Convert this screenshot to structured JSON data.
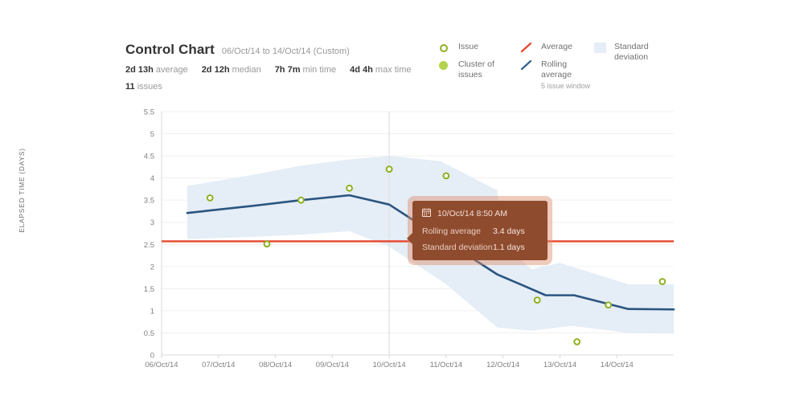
{
  "header": {
    "title": "Control Chart",
    "date_range": "06/Oct/14 to 14/Oct/14 (Custom)",
    "stats": [
      {
        "value": "2d 13h",
        "label": "average"
      },
      {
        "value": "2d 12h",
        "label": "median"
      },
      {
        "value": "7h 7m",
        "label": "min time"
      },
      {
        "value": "4d 4h",
        "label": "max time"
      }
    ],
    "issues_count": "11",
    "issues_label": "issues"
  },
  "legend": {
    "columns": [
      {
        "items": [
          {
            "icon": "hollow-circle-icon",
            "label": "Issue",
            "color": "#8eb021"
          },
          {
            "icon": "filled-circle-icon",
            "label": "Cluster of issues",
            "color": "#b3d44c"
          }
        ]
      },
      {
        "items": [
          {
            "icon": "diagonal-line-icon",
            "label": "Average",
            "color": "#e8452e"
          },
          {
            "icon": "diagonal-line-icon",
            "label": "Rolling average",
            "sub": "5 issue window",
            "color": "#36618e"
          }
        ]
      },
      {
        "items": [
          {
            "icon": "square-swatch-icon",
            "label": "Standard deviation",
            "color": "#e5edf6"
          }
        ]
      }
    ]
  },
  "tooltip": {
    "icon": "calendar-icon",
    "date": "10/Oct/14 8:50 AM",
    "rows": [
      {
        "key": "Rolling average",
        "value": "3.4 days"
      },
      {
        "key": "Standard deviation",
        "value": "1.1 days"
      }
    ]
  },
  "chart_data": {
    "type": "line",
    "title": "Control Chart",
    "xlabel": "",
    "ylabel": "ELAPSED TIME (DAYS)",
    "ylim": [
      0,
      5.5
    ],
    "yticks": [
      0,
      0.5,
      1,
      1.5,
      2,
      2.5,
      3,
      3.5,
      4,
      4.5,
      5,
      5.5
    ],
    "ytick_labels": [
      "0",
      "0.5",
      "1",
      "1.5",
      "2",
      "2.5",
      "3",
      "3.5",
      "4",
      "4.5",
      "5",
      "5.5"
    ],
    "xtick_labels": [
      "06/Oct/14",
      "07/Oct/14",
      "08/Oct/14",
      "09/Oct/14",
      "10/Oct/14",
      "11/Oct/14",
      "12/Oct/14",
      "13/Oct/14",
      "14/Oct/14"
    ],
    "xlim": [
      0,
      9
    ],
    "grid": true,
    "legend_position": "top-right",
    "average_line": {
      "name": "Average",
      "value": 2.57,
      "color": "#e8452e"
    },
    "crosshair_x": 4.0,
    "series": [
      {
        "name": "Rolling average",
        "color": "#2a5580",
        "type": "line",
        "points": [
          {
            "x": 0.45,
            "y": 3.21
          },
          {
            "x": 1.6,
            "y": 3.37
          },
          {
            "x": 2.45,
            "y": 3.5
          },
          {
            "x": 3.3,
            "y": 3.61
          },
          {
            "x": 4.0,
            "y": 3.4
          },
          {
            "x": 5.9,
            "y": 1.82
          },
          {
            "x": 6.3,
            "y": 1.6
          },
          {
            "x": 6.75,
            "y": 1.35
          },
          {
            "x": 7.25,
            "y": 1.35
          },
          {
            "x": 8.2,
            "y": 1.04
          },
          {
            "x": 9.0,
            "y": 1.03
          }
        ]
      },
      {
        "name": "Standard deviation",
        "color": "#e5edf6",
        "type": "band",
        "upper": [
          {
            "x": 0.45,
            "y": 3.82
          },
          {
            "x": 1.6,
            "y": 4.07
          },
          {
            "x": 2.45,
            "y": 4.28
          },
          {
            "x": 3.3,
            "y": 4.42
          },
          {
            "x": 4.0,
            "y": 4.5
          },
          {
            "x": 4.9,
            "y": 4.38
          },
          {
            "x": 5.9,
            "y": 3.72
          },
          {
            "x": 6.0,
            "y": 2.52
          },
          {
            "x": 6.5,
            "y": 1.94
          },
          {
            "x": 7.0,
            "y": 2.08
          },
          {
            "x": 8.2,
            "y": 1.6
          },
          {
            "x": 9.0,
            "y": 1.6
          }
        ],
        "lower": [
          {
            "x": 0.45,
            "y": 2.62
          },
          {
            "x": 1.6,
            "y": 2.67
          },
          {
            "x": 2.45,
            "y": 2.72
          },
          {
            "x": 3.3,
            "y": 2.8
          },
          {
            "x": 4.0,
            "y": 2.45
          },
          {
            "x": 5.0,
            "y": 1.6
          },
          {
            "x": 5.9,
            "y": 0.62
          },
          {
            "x": 6.5,
            "y": 0.55
          },
          {
            "x": 7.2,
            "y": 0.66
          },
          {
            "x": 8.2,
            "y": 0.5
          },
          {
            "x": 9.0,
            "y": 0.48
          }
        ]
      },
      {
        "name": "Issue",
        "color": "#8eb021",
        "type": "scatter",
        "points": [
          {
            "x": 0.85,
            "y": 3.55
          },
          {
            "x": 1.85,
            "y": 2.51
          },
          {
            "x": 2.45,
            "y": 3.5
          },
          {
            "x": 3.3,
            "y": 3.77
          },
          {
            "x": 4.0,
            "y": 4.2
          },
          {
            "x": 5.0,
            "y": 4.05
          },
          {
            "x": 6.0,
            "y": 2.31
          },
          {
            "x": 6.6,
            "y": 1.24
          },
          {
            "x": 7.3,
            "y": 0.3
          },
          {
            "x": 7.85,
            "y": 1.13
          },
          {
            "x": 8.8,
            "y": 1.66
          }
        ]
      }
    ]
  }
}
